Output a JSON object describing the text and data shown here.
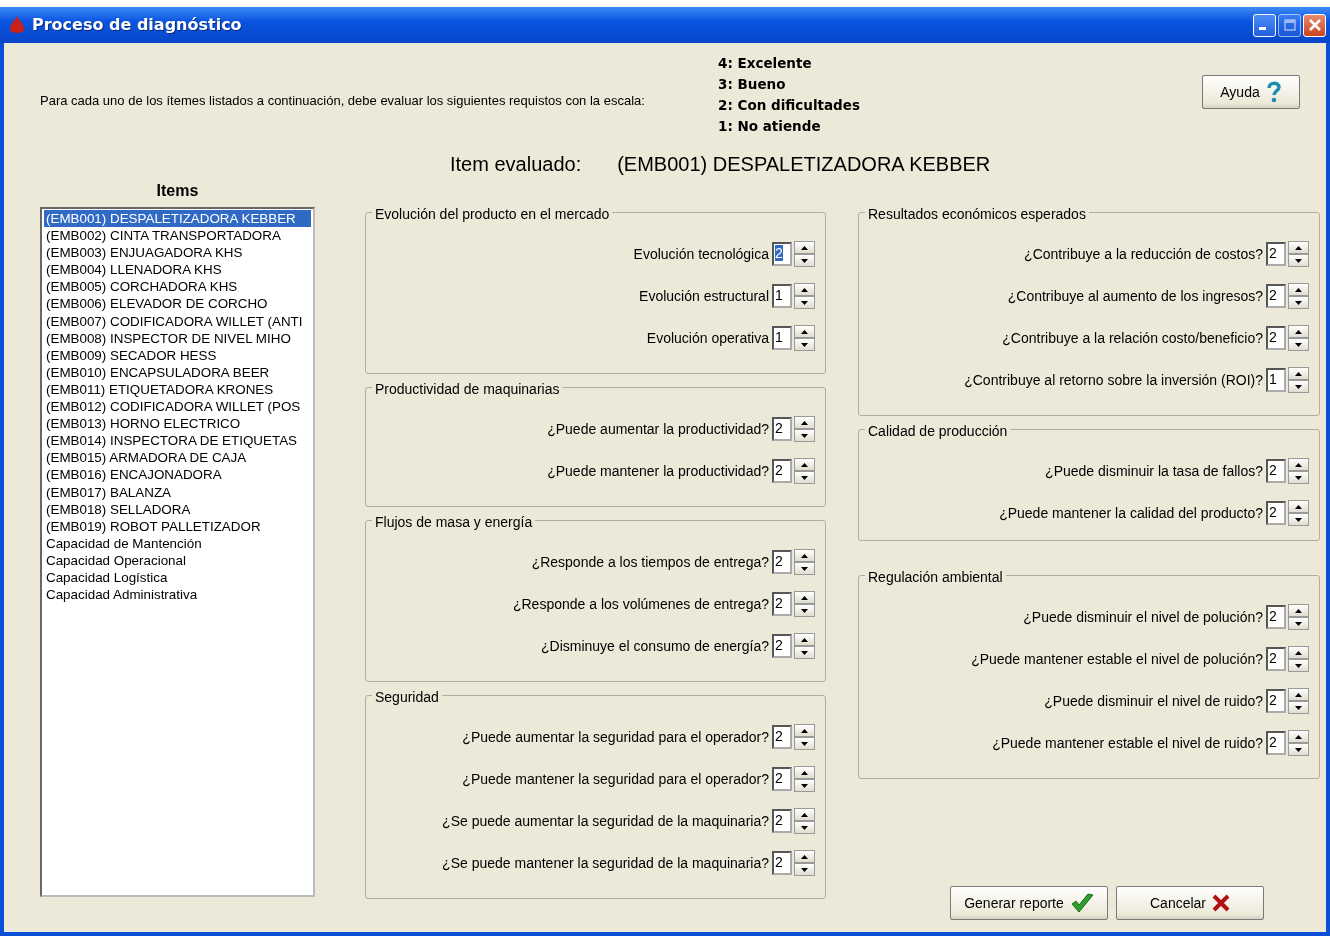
{
  "window": {
    "title": "Proceso de diagnóstico"
  },
  "instructions": "Para cada uno de los ítemes listados a continuación, debe evaluar los siguientes requistos con la escala:",
  "scale": [
    "4: Excelente",
    "3: Bueno",
    "2: Con dificultades",
    "1: No atiende"
  ],
  "help_button": "Ayuda",
  "evaluated": {
    "label": "Item evaluado:",
    "value": "(EMB001) DESPALETIZADORA KEBBER"
  },
  "items_heading": "Items",
  "items": [
    {
      "label": "(EMB001) DESPALETIZADORA KEBBER",
      "selected": true
    },
    {
      "label": "(EMB002) CINTA TRANSPORTADORA",
      "selected": false
    },
    {
      "label": "(EMB003) ENJUAGADORA KHS",
      "selected": false
    },
    {
      "label": "(EMB004) LLENADORA KHS",
      "selected": false
    },
    {
      "label": "(EMB005) CORCHADORA KHS",
      "selected": false
    },
    {
      "label": "(EMB006) ELEVADOR DE CORCHO",
      "selected": false
    },
    {
      "label": "(EMB007) CODIFICADORA WILLET (ANTI",
      "selected": false
    },
    {
      "label": "(EMB008) INSPECTOR DE NIVEL MIHO",
      "selected": false
    },
    {
      "label": "(EMB009) SECADOR HESS",
      "selected": false
    },
    {
      "label": "(EMB010) ENCAPSULADORA BEER",
      "selected": false
    },
    {
      "label": "(EMB011) ETIQUETADORA KRONES",
      "selected": false
    },
    {
      "label": "(EMB012) CODIFICADORA WILLET (POS",
      "selected": false
    },
    {
      "label": "(EMB013) HORNO ELECTRICO",
      "selected": false
    },
    {
      "label": "(EMB014) INSPECTORA DE ETIQUETAS",
      "selected": false
    },
    {
      "label": "(EMB015) ARMADORA DE CAJA",
      "selected": false
    },
    {
      "label": "(EMB016) ENCAJONADORA",
      "selected": false
    },
    {
      "label": "(EMB017) BALANZA",
      "selected": false
    },
    {
      "label": "(EMB018) SELLADORA",
      "selected": false
    },
    {
      "label": "(EMB019) ROBOT PALLETIZADOR",
      "selected": false
    },
    {
      "label": "Capacidad de Mantención",
      "selected": false
    },
    {
      "label": "Capacidad Operacional",
      "selected": false
    },
    {
      "label": "Capacidad Logística",
      "selected": false
    },
    {
      "label": "Capacidad Administrativa",
      "selected": false
    }
  ],
  "groups_middle": [
    {
      "title": "Evolución del producto en el mercado",
      "questions": [
        {
          "label": "Evolución tecnológica",
          "value": "2",
          "focused": true
        },
        {
          "label": "Evolución estructural",
          "value": "1",
          "focused": false
        },
        {
          "label": "Evolución operativa",
          "value": "1",
          "focused": false
        }
      ]
    },
    {
      "title": "Productividad de maquinarias",
      "questions": [
        {
          "label": "¿Puede aumentar la productividad?",
          "value": "2",
          "focused": false
        },
        {
          "label": "¿Puede mantener la productividad?",
          "value": "2",
          "focused": false
        }
      ]
    },
    {
      "title": "Flujos de masa y energía",
      "questions": [
        {
          "label": "¿Responde a los tiempos de entrega?",
          "value": "2",
          "focused": false
        },
        {
          "label": "¿Responde a los volúmenes de entrega?",
          "value": "2",
          "focused": false
        },
        {
          "label": "¿Disminuye el consumo de energía?",
          "value": "2",
          "focused": false
        }
      ]
    },
    {
      "title": "Seguridad",
      "questions": [
        {
          "label": "¿Puede aumentar la seguridad para el operador?",
          "value": "2",
          "focused": false
        },
        {
          "label": "¿Puede mantener la seguridad para el operador?",
          "value": "2",
          "focused": false
        },
        {
          "label": "¿Se puede aumentar la seguridad de la maquinaria?",
          "value": "2",
          "focused": false
        },
        {
          "label": "¿Se puede mantener la seguridad de la maquinaria?",
          "value": "2",
          "focused": false
        }
      ]
    }
  ],
  "groups_right": [
    {
      "title": "Resultados económicos esperados",
      "questions": [
        {
          "label": "¿Contribuye a la reducción de costos?",
          "value": "2",
          "focused": false
        },
        {
          "label": "¿Contribuye al aumento de los ingresos?",
          "value": "2",
          "focused": false
        },
        {
          "label": "¿Contribuye a la relación costo/beneficio?",
          "value": "2",
          "focused": false
        },
        {
          "label": "¿Contribuye al retorno sobre la inversión (ROI)?",
          "value": "1",
          "focused": false
        }
      ]
    },
    {
      "title": "Calidad de producción",
      "questions": [
        {
          "label": "¿Puede disminuir la tasa de fallos?",
          "value": "2",
          "focused": false
        },
        {
          "label": "¿Puede mantener la calidad del producto?",
          "value": "2",
          "focused": false
        }
      ]
    },
    {
      "title": "Regulación ambiental",
      "questions": [
        {
          "label": "¿Puede disminuir el nivel de polución?",
          "value": "2",
          "focused": false
        },
        {
          "label": "¿Puede mantener estable el nivel de polución?",
          "value": "2",
          "focused": false
        },
        {
          "label": "¿Puede disminuir el nivel de ruido?",
          "value": "2",
          "focused": false
        },
        {
          "label": "¿Puede mantener estable el nivel de ruido?",
          "value": "2",
          "focused": false
        }
      ]
    }
  ],
  "buttons": [
    {
      "label": "Generar reporte",
      "kind": "confirm"
    },
    {
      "label": "Cancelar",
      "kind": "cancel"
    }
  ]
}
